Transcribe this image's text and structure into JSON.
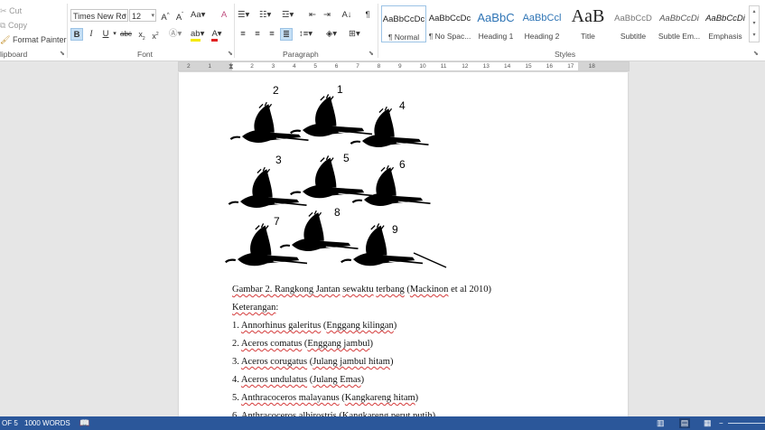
{
  "clipboard": {
    "cut": "Cut",
    "copy": "Copy",
    "format_painter": "Format Painter",
    "label": "lipboard"
  },
  "font": {
    "name": "Times New Ro",
    "size": "12",
    "label": "Font"
  },
  "paragraph": {
    "label": "Paragraph"
  },
  "styles": {
    "label": "Styles",
    "items": [
      {
        "sample": "AaBbCcDc",
        "name": "¶ Normal"
      },
      {
        "sample": "AaBbCcDc",
        "name": "¶ No Spac..."
      },
      {
        "sample": "AaBbC",
        "name": "Heading 1"
      },
      {
        "sample": "AaBbCcl",
        "name": "Heading 2"
      },
      {
        "sample": "AaB",
        "name": "Title"
      },
      {
        "sample": "AaBbCcD",
        "name": "Subtitle"
      },
      {
        "sample": "AaBbCcDi",
        "name": "Subtle Em..."
      },
      {
        "sample": "AaBbCcDi",
        "name": "Emphasis"
      }
    ]
  },
  "ruler": {
    "ticks": [
      "2",
      "1",
      "1",
      "2",
      "3",
      "4",
      "5",
      "6",
      "7",
      "8",
      "9",
      "10",
      "11",
      "12",
      "13",
      "14",
      "15",
      "16",
      "17",
      "18"
    ]
  },
  "figure": {
    "numbers": [
      "2",
      "1",
      "4",
      "3",
      "5",
      "6",
      "7",
      "8",
      "9"
    ]
  },
  "document": {
    "caption_words": [
      "Gambar 2. Rangkong ",
      "Jantan",
      " ",
      "sewaktu",
      " ",
      "terbang",
      " (",
      "Mackinon",
      " et al 2010)"
    ],
    "keterangan": "Keterangan",
    "keterangan_colon": ":",
    "list": [
      {
        "num": "1. ",
        "sci": "Annorhinus galeritus",
        "local": "Enggang kilingan"
      },
      {
        "num": "2. ",
        "sci": "Aceros comatus",
        "local": "Enggang jambul"
      },
      {
        "num": "3. ",
        "sci": "Aceros corugatus",
        "local": "Julang jambul hitam"
      },
      {
        "num": "4. ",
        "sci": "Aceros undulatus",
        "local": "Julang Emas"
      },
      {
        "num": "5. ",
        "sci": "Anthracoceros malayanus",
        "local": "Kangkareng hitam"
      },
      {
        "num": "6. ",
        "sci": "Anthracoceros albirostris",
        "local": "Kangkareng perut putih"
      }
    ]
  },
  "status": {
    "page": "OF 5",
    "words": "1000 WORDS"
  }
}
